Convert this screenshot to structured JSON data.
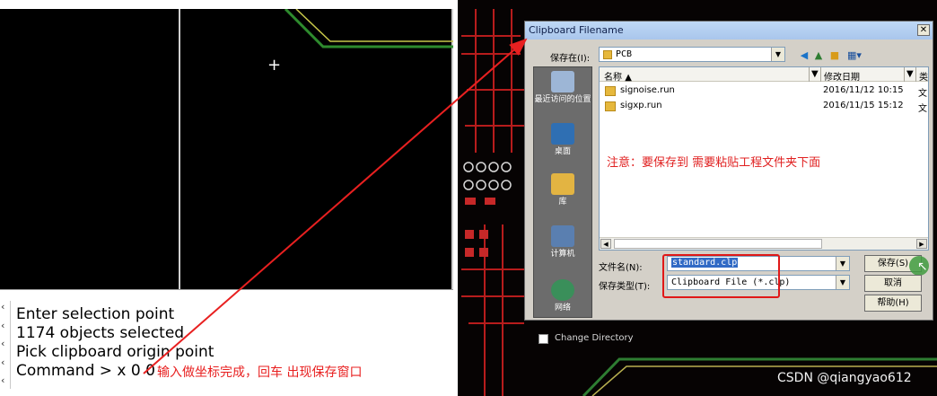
{
  "console": {
    "lines": [
      "Enter selection point",
      "1174 objects selected",
      "Pick clipboard origin point",
      "Command > x 0 0"
    ]
  },
  "annotations": {
    "left_note": "输入做坐标完成，回车  出现保存窗口",
    "dialog_note": "注意：要保存到 需要粘贴工程文件夹下面"
  },
  "dialog": {
    "title": "Clipboard Filename",
    "close": "✕",
    "save_in_label": "保存在(I):",
    "save_in_value": "PCB",
    "places": [
      "最近访问的位置",
      "桌面",
      "库",
      "计算机",
      "网络"
    ],
    "columns": {
      "name": "名称",
      "date": "修改日期",
      "type": "类"
    },
    "files": [
      {
        "name": "signoise.run",
        "date": "2016/11/12 10:15",
        "type": "文"
      },
      {
        "name": "sigxp.run",
        "date": "2016/11/15 15:12",
        "type": "文"
      }
    ],
    "filename_label": "文件名(N):",
    "filename_value": "standard.clp",
    "filetype_label": "保存类型(T):",
    "filetype_value": "Clipboard File (*.clp)",
    "buttons": {
      "save": "保存(S)",
      "cancel": "取消",
      "help": "帮助(H)"
    },
    "change_directory": "Change Directory"
  },
  "watermark": "CSDN @qiangyao612",
  "colors": {
    "annotation": "#e82020",
    "pcb_trace": "#c62828",
    "pcb_green": "#2e7d32"
  }
}
